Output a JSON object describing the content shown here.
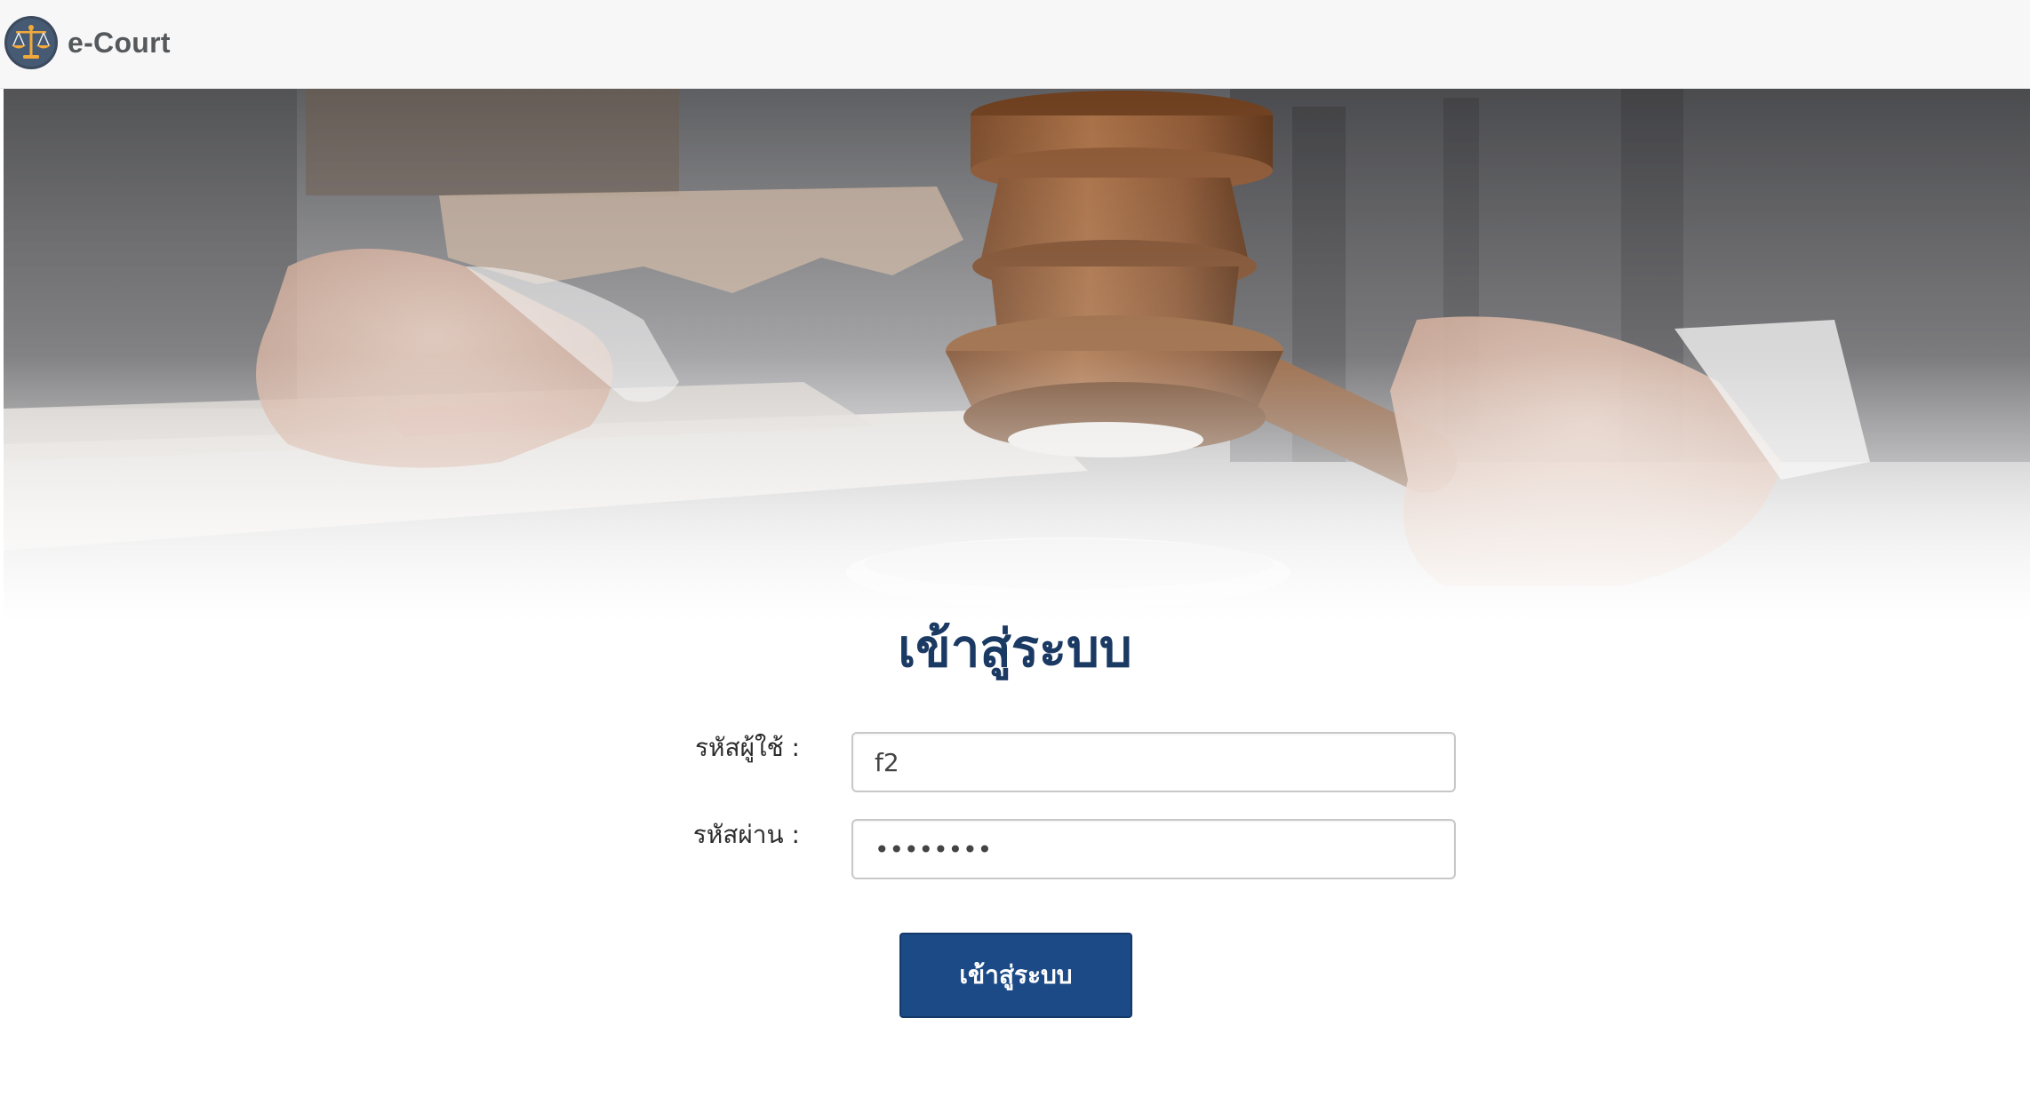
{
  "header": {
    "brand_text": "e-Court",
    "logo_icon": "scales-of-justice-icon",
    "background_color": "#f7f7f7"
  },
  "hero": {
    "image": "judge-gavel-photo"
  },
  "login": {
    "title": "เข้าสู่ระบบ",
    "username_label": "รหัสผู้ใช้ :",
    "username_value": "f2",
    "password_label": "รหัสผ่าน :",
    "password_value": "12345678",
    "submit_label": "เข้าสู่ระบบ",
    "accent_color": "#1c4a86",
    "title_color": "#1b3a63"
  }
}
